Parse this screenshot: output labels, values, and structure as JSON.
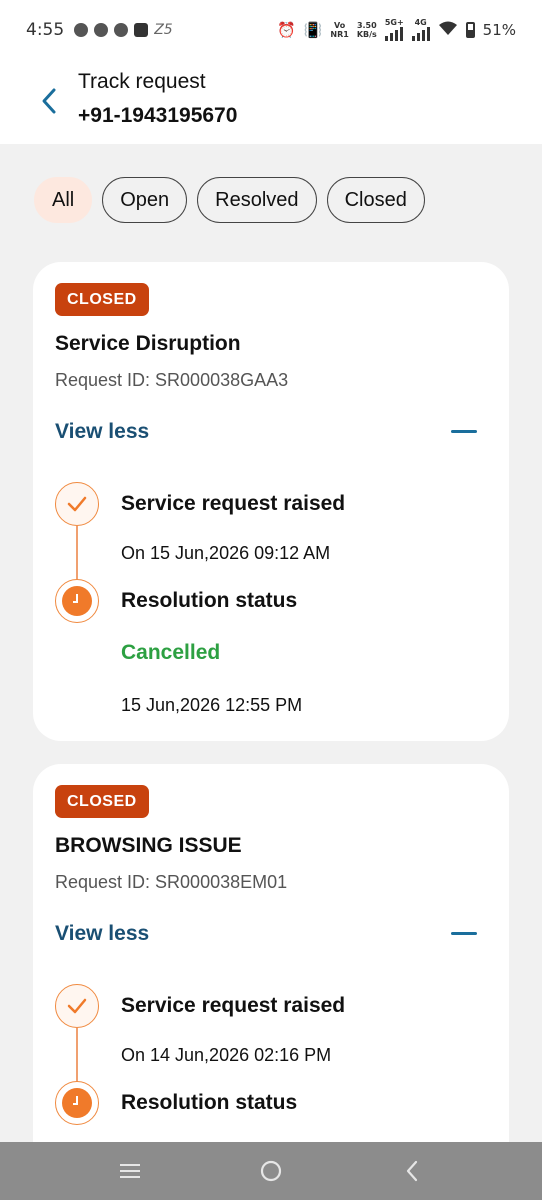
{
  "status_bar": {
    "time": "4:55",
    "z_label": "Z5",
    "network_vo": "Vo",
    "network_nr": "NR1",
    "speed": "3.50",
    "speed_unit": "KB/s",
    "net_5g": "5G+",
    "net_4g": "4G",
    "battery": "51%"
  },
  "header": {
    "title": "Track request",
    "phone": "+91-1943195670"
  },
  "filters": [
    "All",
    "Open",
    "Resolved",
    "Closed"
  ],
  "requests": [
    {
      "badge": "CLOSED",
      "title": "Service Disruption",
      "request_id": "Request ID: SR000038GAA3",
      "toggle": "View less",
      "raised_title": "Service request raised",
      "raised_date": "On 15 Jun,2026 09:12 AM",
      "resolution_title": "Resolution status",
      "resolution_status": "Cancelled",
      "resolution_date": "15 Jun,2026 12:55 PM"
    },
    {
      "badge": "CLOSED",
      "title": "BROWSING ISSUE",
      "request_id": "Request ID: SR000038EM01",
      "toggle": "View less",
      "raised_title": "Service request raised",
      "raised_date": "On 14 Jun,2026 02:16 PM",
      "resolution_title": "Resolution status"
    }
  ],
  "colors": {
    "accent_orange": "#f07a2a",
    "badge": "#c8420e",
    "link_blue": "#1a4f73",
    "status_green": "#2da042"
  }
}
